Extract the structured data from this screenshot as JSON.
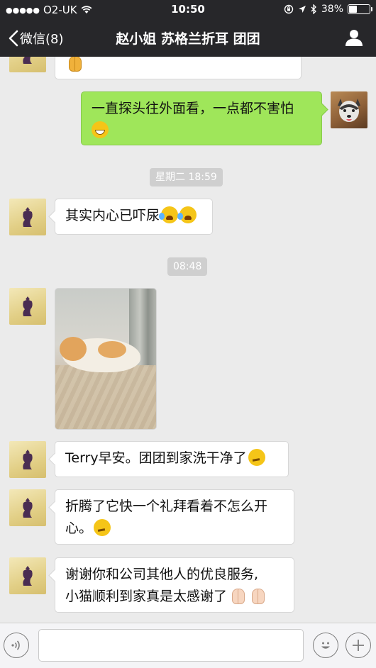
{
  "status_bar": {
    "carrier": "O2-UK",
    "time": "10:50",
    "battery_percent": "38%",
    "battery_level": 0.38
  },
  "nav": {
    "back_label": "微信(8)",
    "title": "赵小姐 苏格兰折耳 团团",
    "back_icon": "chevron-left-icon",
    "profile_icon": "person-icon"
  },
  "messages": [
    {
      "id": "m0",
      "side": "in",
      "text": ""
    },
    {
      "id": "m1",
      "side": "out",
      "text": "一直探头往外面看，一点都不害怕"
    },
    {
      "id": "ts1",
      "type": "timestamp",
      "text": "星期二 18:59"
    },
    {
      "id": "m2",
      "side": "in",
      "text": "其实内心已吓尿"
    },
    {
      "id": "ts2",
      "type": "timestamp",
      "text": "08:48"
    },
    {
      "id": "m3",
      "side": "in",
      "type": "image",
      "alt": "cat photo"
    },
    {
      "id": "m4",
      "side": "in",
      "text": "Terry早安。团团到家洗干净了"
    },
    {
      "id": "m5",
      "side": "in",
      "text": "折腾了它快一个礼拜看着不怎么开心。"
    },
    {
      "id": "m6",
      "side": "in",
      "text_line1": "谢谢你和公司其他人的优良服务,",
      "text_line2": "小猫顺利到家真是太感谢了"
    }
  ],
  "input_bar": {
    "voice_icon": "voice-icon",
    "emoji_icon": "emoji-icon",
    "plus_icon": "plus-icon",
    "placeholder": ""
  },
  "colors": {
    "nav_bg": "#27272a",
    "chat_bg": "#ebebeb",
    "out_bubble": "#9fe65a",
    "in_bubble": "#ffffff"
  }
}
